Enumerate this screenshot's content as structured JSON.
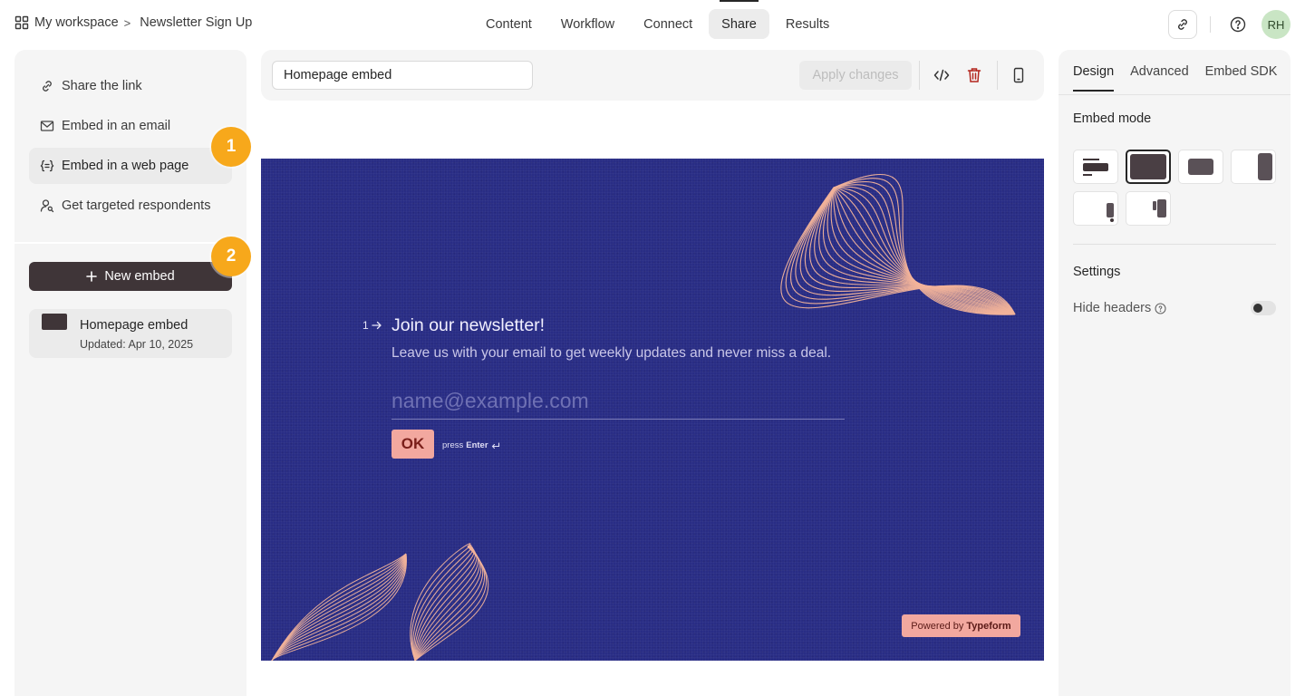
{
  "breadcrumb": {
    "workspace": "My workspace",
    "separator": ">",
    "form": "Newsletter Sign Up"
  },
  "nav": {
    "tabs": [
      "Content",
      "Workflow",
      "Connect",
      "Share",
      "Results"
    ],
    "active": "Share"
  },
  "user": {
    "initials": "RH",
    "avatar_color": "#c9e5c4"
  },
  "left_menu": {
    "items": [
      {
        "label": "Share the link",
        "icon": "link-icon"
      },
      {
        "label": "Embed in an email",
        "icon": "mail-icon"
      },
      {
        "label": "Embed in a web page",
        "icon": "code-brackets-icon",
        "active": true
      },
      {
        "label": "Get targeted respondents",
        "icon": "user-search-icon"
      }
    ],
    "new_embed_label": "New embed",
    "embeds": [
      {
        "name": "Homepage embed",
        "updated": "Updated: Apr 10, 2025"
      }
    ]
  },
  "badges": [
    "1",
    "2"
  ],
  "toolbar": {
    "embed_name": "Homepage embed",
    "apply_label": "Apply changes"
  },
  "preview": {
    "question_number": "1",
    "title": "Join our newsletter!",
    "description": "Leave us with your email to get weekly updates and never miss a deal.",
    "input_placeholder": "name@example.com",
    "ok_label": "OK",
    "press_label": "press",
    "enter_label": "Enter",
    "powered_by": "Powered by",
    "brand": "Typeform",
    "bg_color": "#292d85",
    "accent_color": "#f2a89f"
  },
  "right_panel": {
    "tabs": [
      "Design",
      "Advanced",
      "Embed SDK"
    ],
    "active_tab": "Design",
    "embed_mode_title": "Embed mode",
    "modes": [
      "standard",
      "full-page",
      "popup",
      "slider",
      "popover",
      "side-tab"
    ],
    "selected_mode": "full-page",
    "settings_title": "Settings",
    "hide_headers_label": "Hide headers",
    "hide_headers_on": false
  },
  "colors": {
    "primary_dark": "#3f3538",
    "badge": "#f7a81b",
    "panel_bg": "#f5f5f5"
  }
}
